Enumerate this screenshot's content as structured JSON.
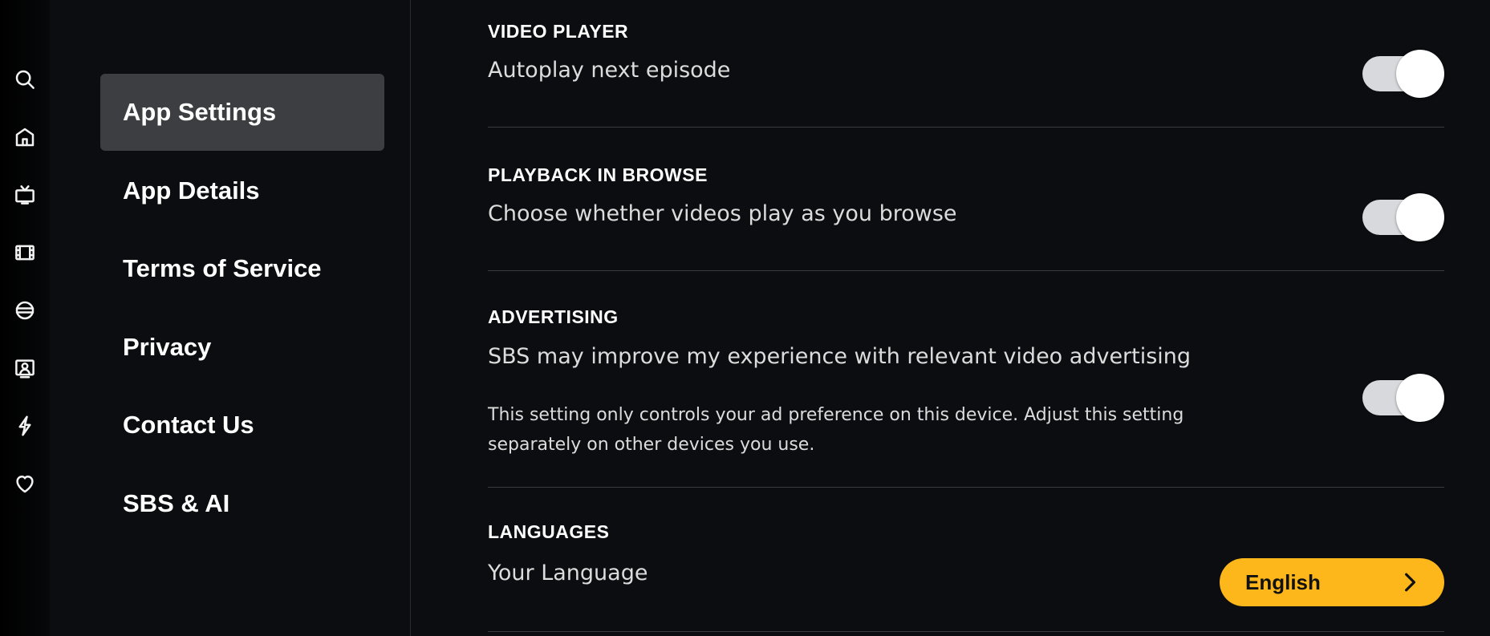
{
  "rail": {
    "icons": [
      "search-icon",
      "home-icon",
      "tv-icon",
      "film-icon",
      "sport-icon",
      "profile-icon",
      "flash-icon",
      "heart-icon"
    ]
  },
  "menu": {
    "items": [
      {
        "label": "App Settings",
        "active": true
      },
      {
        "label": "App Details",
        "active": false
      },
      {
        "label": "Terms of Service",
        "active": false
      },
      {
        "label": "Privacy",
        "active": false
      },
      {
        "label": "Contact Us",
        "active": false
      },
      {
        "label": "SBS & AI",
        "active": false
      }
    ]
  },
  "sections": {
    "video_player": {
      "title": "VIDEO PLAYER",
      "description": "Autoplay next episode",
      "toggle_on": true
    },
    "playback": {
      "title": "PLAYBACK IN BROWSE",
      "description": "Choose whether videos play as you browse",
      "toggle_on": true
    },
    "advertising": {
      "title": "ADVERTISING",
      "description": "SBS may improve my experience with relevant video advertising",
      "note": "This setting only controls your ad preference on this device. Adjust this setting separately on other devices you use.",
      "toggle_on": true
    },
    "languages": {
      "title": "LANGUAGES",
      "description": "Your Language",
      "button_label": "English"
    }
  },
  "colors": {
    "background": "#0b0d10",
    "active_menu": "#3d3e41",
    "accent": "#fdb71a",
    "toggle_track": "#d7d9dc"
  }
}
